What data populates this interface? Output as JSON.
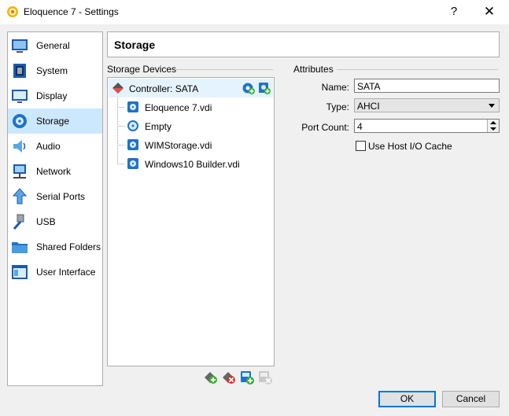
{
  "window": {
    "title": "Eloquence 7 - Settings",
    "help": "?",
    "close": "✕"
  },
  "sidebar": {
    "items": [
      {
        "label": "General",
        "icon": "general-icon"
      },
      {
        "label": "System",
        "icon": "system-icon"
      },
      {
        "label": "Display",
        "icon": "display-icon"
      },
      {
        "label": "Storage",
        "icon": "storage-icon",
        "selected": true
      },
      {
        "label": "Audio",
        "icon": "audio-icon"
      },
      {
        "label": "Network",
        "icon": "network-icon"
      },
      {
        "label": "Serial Ports",
        "icon": "serial-ports-icon"
      },
      {
        "label": "USB",
        "icon": "usb-icon"
      },
      {
        "label": "Shared Folders",
        "icon": "shared-folders-icon"
      },
      {
        "label": "User Interface",
        "icon": "user-interface-icon"
      }
    ]
  },
  "header": {
    "title": "Storage"
  },
  "storage_devices": {
    "label": "Storage Devices",
    "controller": "Controller: SATA",
    "attachments": [
      {
        "label": "Eloquence 7.vdi",
        "icon": "hard-disk-icon"
      },
      {
        "label": "Empty",
        "icon": "optical-disc-icon"
      },
      {
        "label": "WIMStorage.vdi",
        "icon": "hard-disk-icon"
      },
      {
        "label": "Windows10 Builder.vdi",
        "icon": "hard-disk-icon"
      }
    ]
  },
  "attributes": {
    "label": "Attributes",
    "name_label": "Name:",
    "name_value": "SATA",
    "type_label": "Type:",
    "type_value": "AHCI",
    "port_count_label": "Port Count:",
    "port_count_value": "4",
    "host_io_cache_label": "Use Host I/O Cache",
    "host_io_cache_checked": false
  },
  "buttons": {
    "ok": "OK",
    "cancel": "Cancel"
  },
  "colors": {
    "selection": "#cce8ff",
    "accent": "#0078d7",
    "tree_selection": "#e5f3ff"
  }
}
